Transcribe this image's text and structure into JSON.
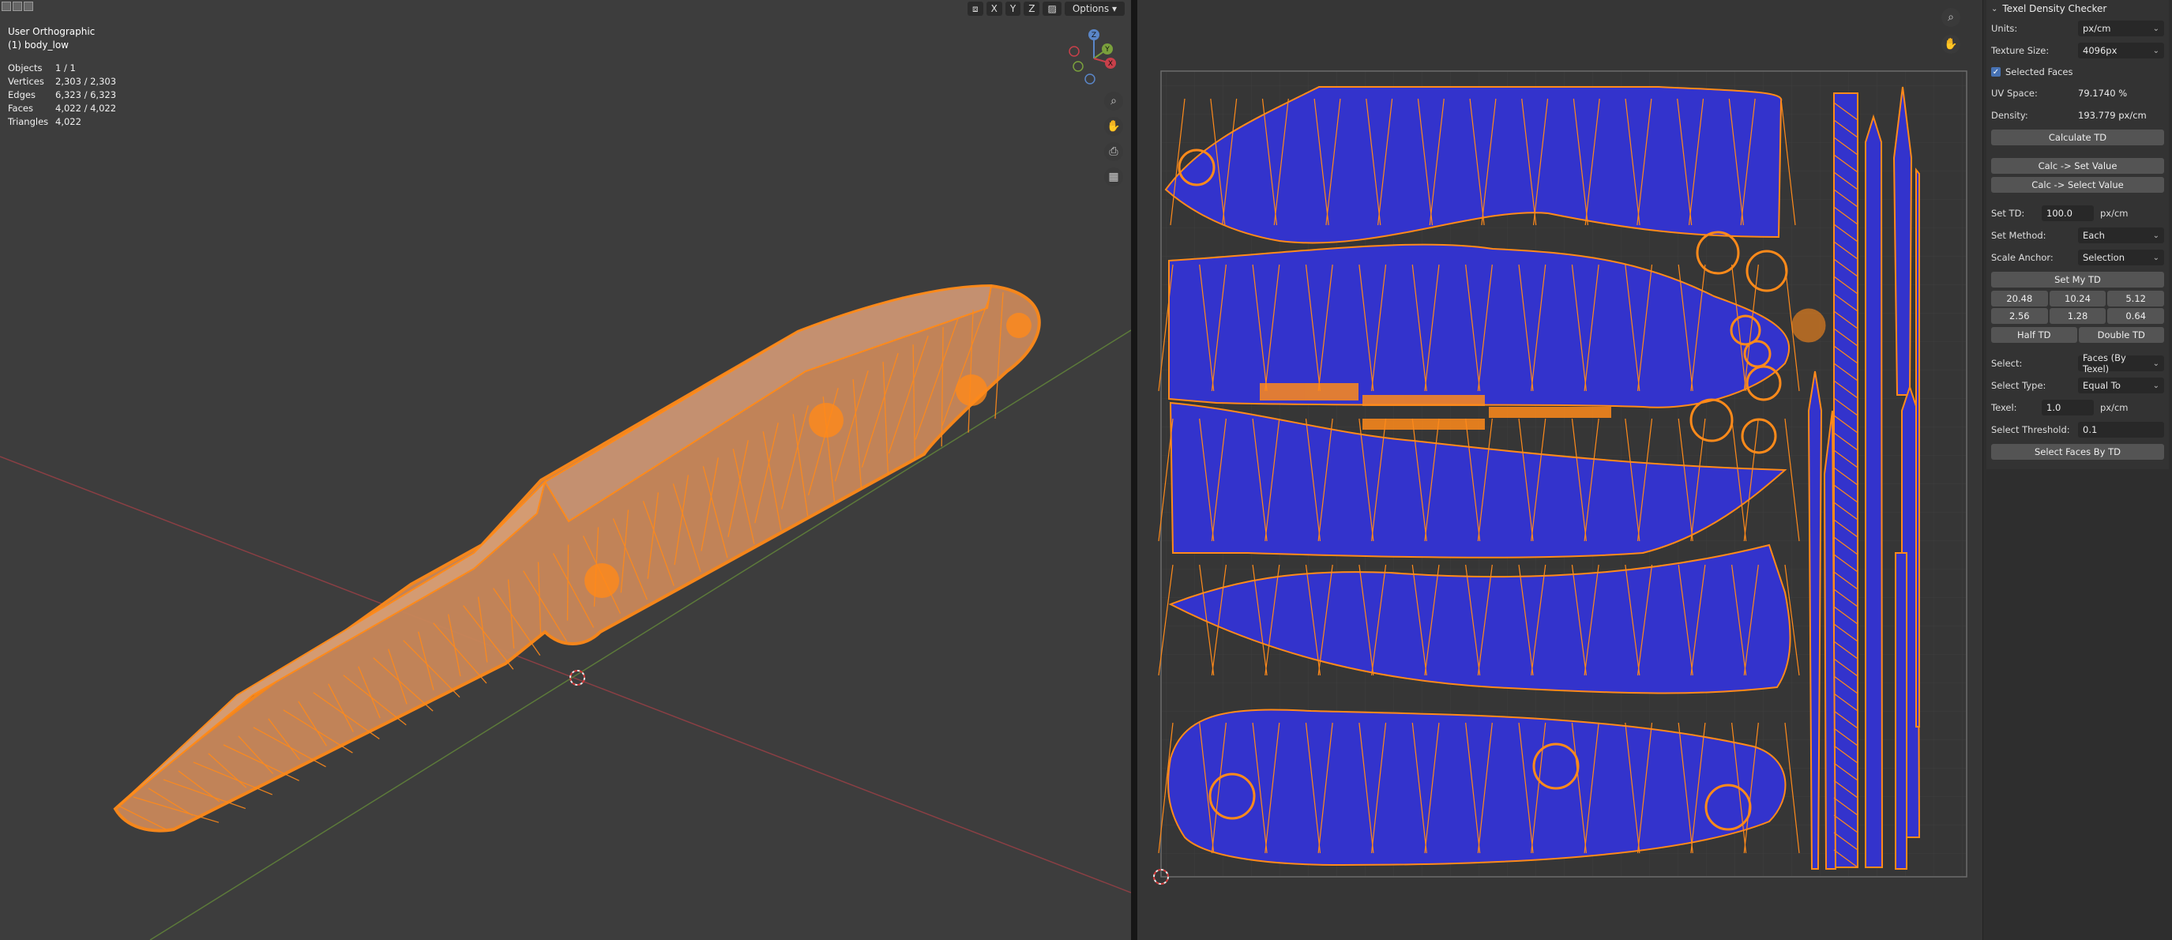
{
  "viewport": {
    "view_name": "User Orthographic",
    "object_name": "(1) body_low",
    "stats": [
      {
        "label": "Objects",
        "value": "1 / 1"
      },
      {
        "label": "Vertices",
        "value": "2,303 / 2,303"
      },
      {
        "label": "Edges",
        "value": "6,323 / 6,323"
      },
      {
        "label": "Faces",
        "value": "4,022 / 4,022"
      },
      {
        "label": "Triangles",
        "value": "4,022"
      }
    ],
    "header": {
      "x": "X",
      "y": "Y",
      "z": "Z",
      "options": "Options"
    },
    "gizmo": {
      "x": "X",
      "y": "Y",
      "z": "Z"
    }
  },
  "panel": {
    "title": "Texel Density Checker",
    "units_label": "Units:",
    "units_value": "px/cm",
    "texture_size_label": "Texture Size:",
    "texture_size_value": "4096px",
    "selected_faces_label": "Selected Faces",
    "uv_space_label": "UV Space:",
    "uv_space_value": "79.1740 %",
    "density_label": "Density:",
    "density_value": "193.779 px/cm",
    "calculate_td": "Calculate TD",
    "calc_set_value": "Calc -> Set Value",
    "calc_select_value": "Calc -> Select Value",
    "set_td_label": "Set TD:",
    "set_td_value": "100.0",
    "set_td_unit": "px/cm",
    "set_method_label": "Set Method:",
    "set_method_value": "Each",
    "scale_anchor_label": "Scale Anchor:",
    "scale_anchor_value": "Selection",
    "set_my_td": "Set My TD",
    "presets": [
      "20.48",
      "10.24",
      "5.12",
      "2.56",
      "1.28",
      "0.64"
    ],
    "half_td": "Half TD",
    "double_td": "Double TD",
    "select_label": "Select:",
    "select_value": "Faces (By Texel)",
    "select_type_label": "Select Type:",
    "select_type_value": "Equal To",
    "texel_label": "Texel:",
    "texel_value": "1.0",
    "texel_unit": "px/cm",
    "threshold_label": "Select Threshold:",
    "threshold_value": "0.1",
    "select_faces_by_td": "Select Faces By TD"
  },
  "colors": {
    "viewport_bg": "#3d3d3d",
    "mesh_orange": "#ff8a1a",
    "uv_fill": "#3333cc",
    "uv_bg": "#363636"
  }
}
